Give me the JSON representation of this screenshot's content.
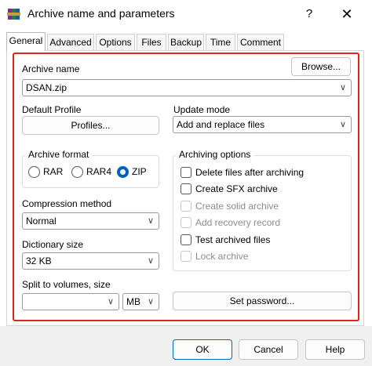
{
  "window": {
    "title": "Archive name and parameters",
    "help_glyph": "?",
    "close_glyph": "✕"
  },
  "tabs": [
    {
      "label": "General",
      "active": true
    },
    {
      "label": "Advanced"
    },
    {
      "label": "Options"
    },
    {
      "label": "Files"
    },
    {
      "label": "Backup"
    },
    {
      "label": "Time"
    },
    {
      "label": "Comment"
    }
  ],
  "archive_name": {
    "label": "Archive name",
    "value": "DSAN.zip",
    "browse_label": "Browse..."
  },
  "default_profile": {
    "label": "Default Profile",
    "button_label": "Profiles..."
  },
  "update_mode": {
    "label": "Update mode",
    "value": "Add and replace files"
  },
  "archive_format": {
    "title": "Archive format",
    "options": [
      {
        "label": "RAR",
        "selected": false
      },
      {
        "label": "RAR4",
        "selected": false
      },
      {
        "label": "ZIP",
        "selected": true
      }
    ]
  },
  "compression_method": {
    "label": "Compression method",
    "value": "Normal"
  },
  "dictionary_size": {
    "label": "Dictionary size",
    "value": "32 KB"
  },
  "split_volumes": {
    "label": "Split to volumes, size",
    "value": "",
    "unit": "MB"
  },
  "archiving_options": {
    "title": "Archiving options",
    "items": [
      {
        "label": "Delete files after archiving",
        "checked": false,
        "enabled": true
      },
      {
        "label": "Create SFX archive",
        "checked": false,
        "enabled": true
      },
      {
        "label": "Create solid archive",
        "checked": false,
        "enabled": false
      },
      {
        "label": "Add recovery record",
        "checked": false,
        "enabled": false
      },
      {
        "label": "Test archived files",
        "checked": false,
        "enabled": true
      },
      {
        "label": "Lock archive",
        "checked": false,
        "enabled": false
      }
    ]
  },
  "set_password_label": "Set password...",
  "footer": {
    "ok_label": "OK",
    "cancel_label": "Cancel",
    "help_label": "Help"
  },
  "colors": {
    "highlight": "#e02424",
    "radio_selected": "#0060c0"
  },
  "icons": {
    "app": "winrar-books-icon",
    "dropdown": "chevron-down-icon"
  }
}
